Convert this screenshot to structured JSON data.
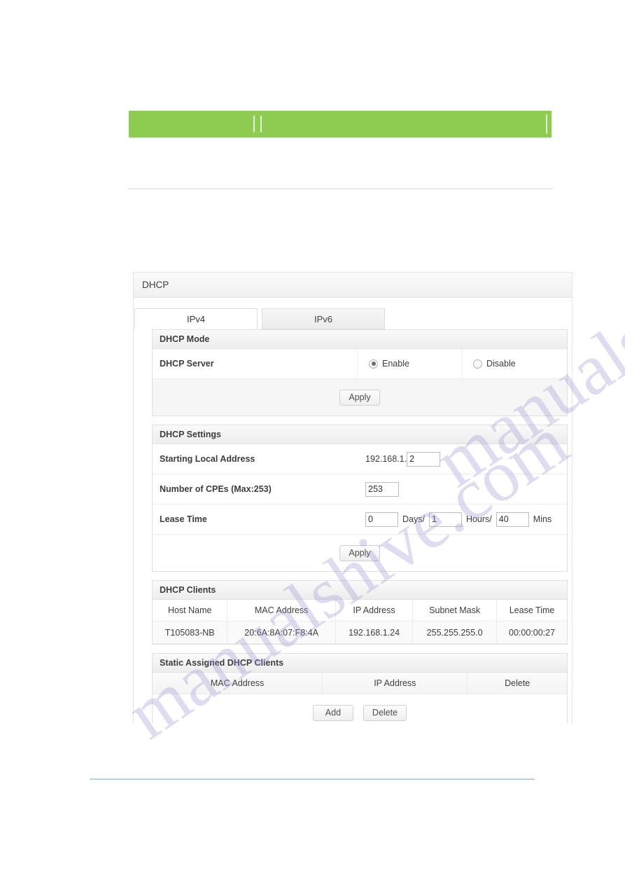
{
  "banner": {
    "color": "#8ecc51",
    "label": ""
  },
  "panel": {
    "title": "DHCP",
    "tabs": [
      {
        "label": "IPv4",
        "active": true
      },
      {
        "label": "IPv6",
        "active": false
      }
    ]
  },
  "dhcp_mode": {
    "title": "DHCP Mode",
    "server_label": "DHCP Server",
    "enable_label": "Enable",
    "disable_label": "Disable",
    "selected": "Enable",
    "apply_label": "Apply"
  },
  "dhcp_settings": {
    "title": "DHCP Settings",
    "starting_local_address_label": "Starting Local Address",
    "starting_local_address_prefix": "192.168.1.",
    "starting_local_address_value": "2",
    "number_of_cpes_label": "Number of CPEs (Max:253)",
    "number_of_cpes_value": "253",
    "lease_time_label": "Lease Time",
    "lease_days_value": "0",
    "lease_days_unit": "Days/",
    "lease_hours_value": "1",
    "lease_hours_unit": "Hours/",
    "lease_mins_value": "40",
    "lease_mins_unit": "Mins",
    "apply_label": "Apply"
  },
  "dhcp_clients": {
    "title": "DHCP Clients",
    "columns": [
      "Host Name",
      "MAC Address",
      "IP Address",
      "Subnet Mask",
      "Lease Time"
    ],
    "rows": [
      [
        "T105083-NB",
        "20:6A:8A:07:F8:4A",
        "192.168.1.24",
        "255.255.255.0",
        "00:00:00:27"
      ]
    ]
  },
  "static_clients": {
    "title": "Static Assigned DHCP Clients",
    "columns": [
      "MAC Address",
      "IP Address",
      "Delete"
    ],
    "rows": [],
    "add_label": "Add",
    "delete_label": "Delete"
  },
  "watermark": {
    "text_a": "manualshive.com",
    "text_b": "manualshive.com"
  }
}
